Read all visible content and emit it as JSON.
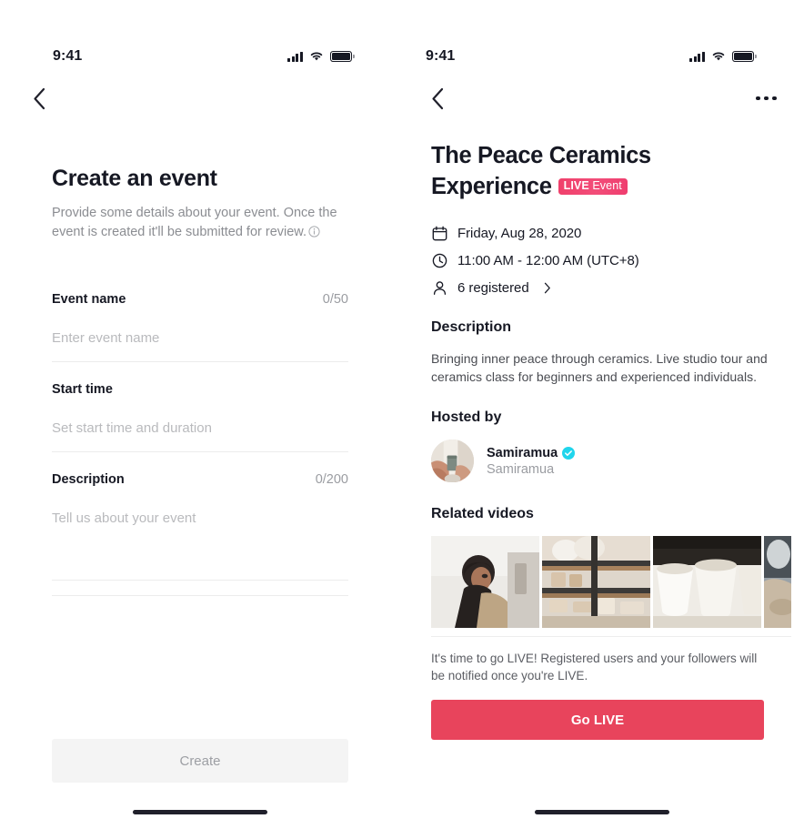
{
  "status_bar": {
    "time": "9:41",
    "signal_icon": "signal-bars-icon",
    "wifi_icon": "wifi-icon",
    "battery_icon": "battery-icon"
  },
  "create_screen": {
    "back_icon": "back-chevron-icon",
    "title": "Create an event",
    "subtitle": "Provide some details about your event. Once the event is created it'll be submitted for review.",
    "info_icon": "info-circle-icon",
    "fields": [
      {
        "label": "Event name",
        "counter": "0/50",
        "placeholder": "Enter event name",
        "value": ""
      },
      {
        "label": "Start time",
        "counter": "",
        "placeholder": "Set start time and duration",
        "value": ""
      },
      {
        "label": "Description",
        "counter": "0/200",
        "placeholder": "Tell us about your event",
        "value": ""
      }
    ],
    "submit_label": "Create"
  },
  "detail_screen": {
    "back_icon": "back-chevron-icon",
    "more_icon": "more-options-icon",
    "title": "The Peace Ceramics Experience",
    "badge": {
      "live_word": "LIVE",
      "event_word": "Event",
      "color": "#f0406b"
    },
    "meta": [
      {
        "icon": "calendar-icon",
        "text": "Friday, Aug 28, 2020",
        "chevron": false
      },
      {
        "icon": "clock-icon",
        "text": "11:00 AM - 12:00 AM (UTC+8)",
        "chevron": false
      },
      {
        "icon": "person-icon",
        "text": "6 registered",
        "chevron": true
      }
    ],
    "description_heading": "Description",
    "description_text": "Bringing inner peace through ceramics. Live studio tour and ceramics class for beginners and experienced individuals.",
    "hosted_by_heading": "Hosted by",
    "host": {
      "avatar_icon": "host-avatar",
      "name": "Samiramua",
      "handle": "Samiramua",
      "verified_icon": "verified-badge-icon",
      "verified_color": "#20d5ec"
    },
    "related_videos_heading": "Related videos",
    "related_videos": [
      {
        "name": "potter-at-work-thumbnail"
      },
      {
        "name": "pottery-shelves-thumbnail"
      },
      {
        "name": "white-bowls-thumbnail"
      },
      {
        "name": "pottery-wheel-thumbnail-partial"
      }
    ],
    "golive_note": "It's time to go LIVE! Registered users and your followers will be notified once you're LIVE.",
    "golive_label": "Go LIVE",
    "golive_color": "#e8445c"
  }
}
